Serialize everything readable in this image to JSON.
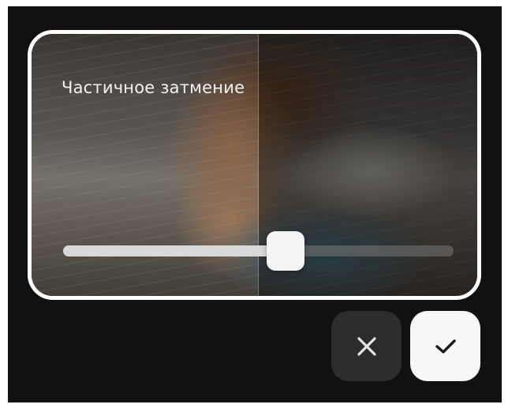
{
  "preview": {
    "title": "Частичное затмение"
  },
  "slider": {
    "value_percent": 57
  },
  "actions": {
    "cancel_icon": "close-icon",
    "confirm_icon": "checkmark-icon"
  },
  "colors": {
    "background": "#111111",
    "card_border": "#ffffff",
    "cancel_button": "#2d2d2d",
    "confirm_button": "#f7f7f7"
  }
}
